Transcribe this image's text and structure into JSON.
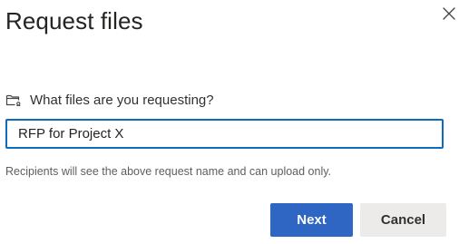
{
  "dialog": {
    "title": "Request files",
    "close_icon": "close-icon",
    "prompt": {
      "icon": "folder-request-icon",
      "label": "What files are you requesting?"
    },
    "input": {
      "value": "RFP for Project X",
      "placeholder": ""
    },
    "helper_text": "Recipients will see the above request name and can upload only.",
    "buttons": {
      "next_label": "Next",
      "cancel_label": "Cancel"
    }
  },
  "colors": {
    "primary": "#2F66C4",
    "input_border": "#0F6CBD",
    "secondary_button_bg": "#ECEBEA",
    "helper_text": "#605E5C"
  }
}
